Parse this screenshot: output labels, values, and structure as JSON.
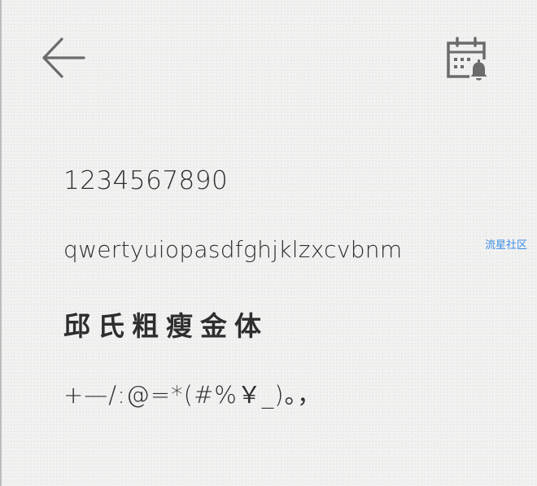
{
  "toolbar": {
    "back_icon": "arrow-left-icon",
    "reminder_icon": "calendar-bell-icon",
    "icon_color": "#6b6b6b"
  },
  "note": {
    "lines": [
      "1234567890",
      "qwertyuiopasdfghjklzxcvbnm",
      "邱氏粗瘦金体",
      "+—/:@=*(#%￥_)。，"
    ],
    "text_color": "#2e2e2e"
  },
  "watermark": {
    "text": "流星社区",
    "color": "#3a8ee6"
  },
  "background_color": "#f1f1f0"
}
